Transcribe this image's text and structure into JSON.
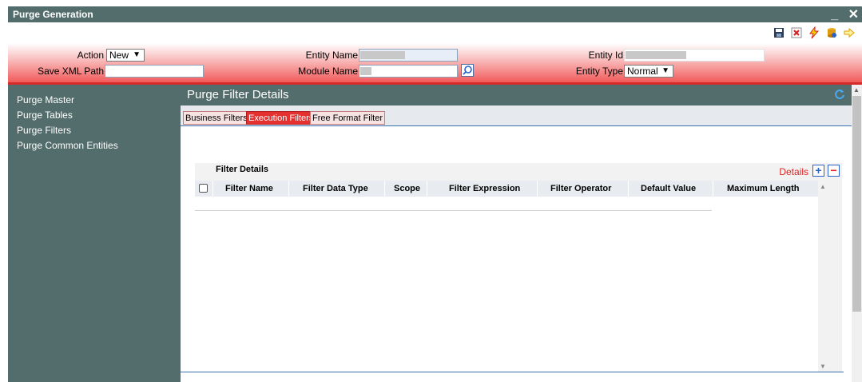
{
  "window": {
    "title": "Purge Generation",
    "minimize_glyph": "_",
    "close_glyph": "✕"
  },
  "toolbar": {
    "icons": [
      "save-icon",
      "delete-icon",
      "lightning-icon",
      "database-icon",
      "exit-arrow-icon"
    ]
  },
  "header": {
    "action_label": "Action",
    "action_value": "New",
    "save_xml_path_label": "Save XML Path",
    "save_xml_path_value": "",
    "entity_name_label": "Entity Name",
    "module_name_label": "Module Name",
    "entity_id_label": "Entity Id",
    "entity_type_label": "Entity Type",
    "entity_type_value": "Normal"
  },
  "sidebar": {
    "items": [
      {
        "label": "Purge Master"
      },
      {
        "label": "Purge Tables"
      },
      {
        "label": "Purge Filters"
      },
      {
        "label": "Purge Common Entities"
      }
    ]
  },
  "main": {
    "title": "Purge Filter Details",
    "tabs": [
      {
        "label": "Business Filters",
        "active": false
      },
      {
        "label": "Execution Filters",
        "active": true
      },
      {
        "label": "Free Format Filter",
        "active": false
      }
    ],
    "filter_details": {
      "title": "Filter Details",
      "details_link": "Details",
      "add_glyph": "+",
      "remove_glyph": "−",
      "columns": [
        "Filter Name",
        "Filter Data Type",
        "Scope",
        "Filter Expression",
        "Filter Operator",
        "Default Value",
        "Maximum Length"
      ],
      "rows": []
    }
  },
  "colors": {
    "header_teal": "#526d6b",
    "accent_red": "#e53030",
    "link_blue": "#3a6fb0"
  }
}
